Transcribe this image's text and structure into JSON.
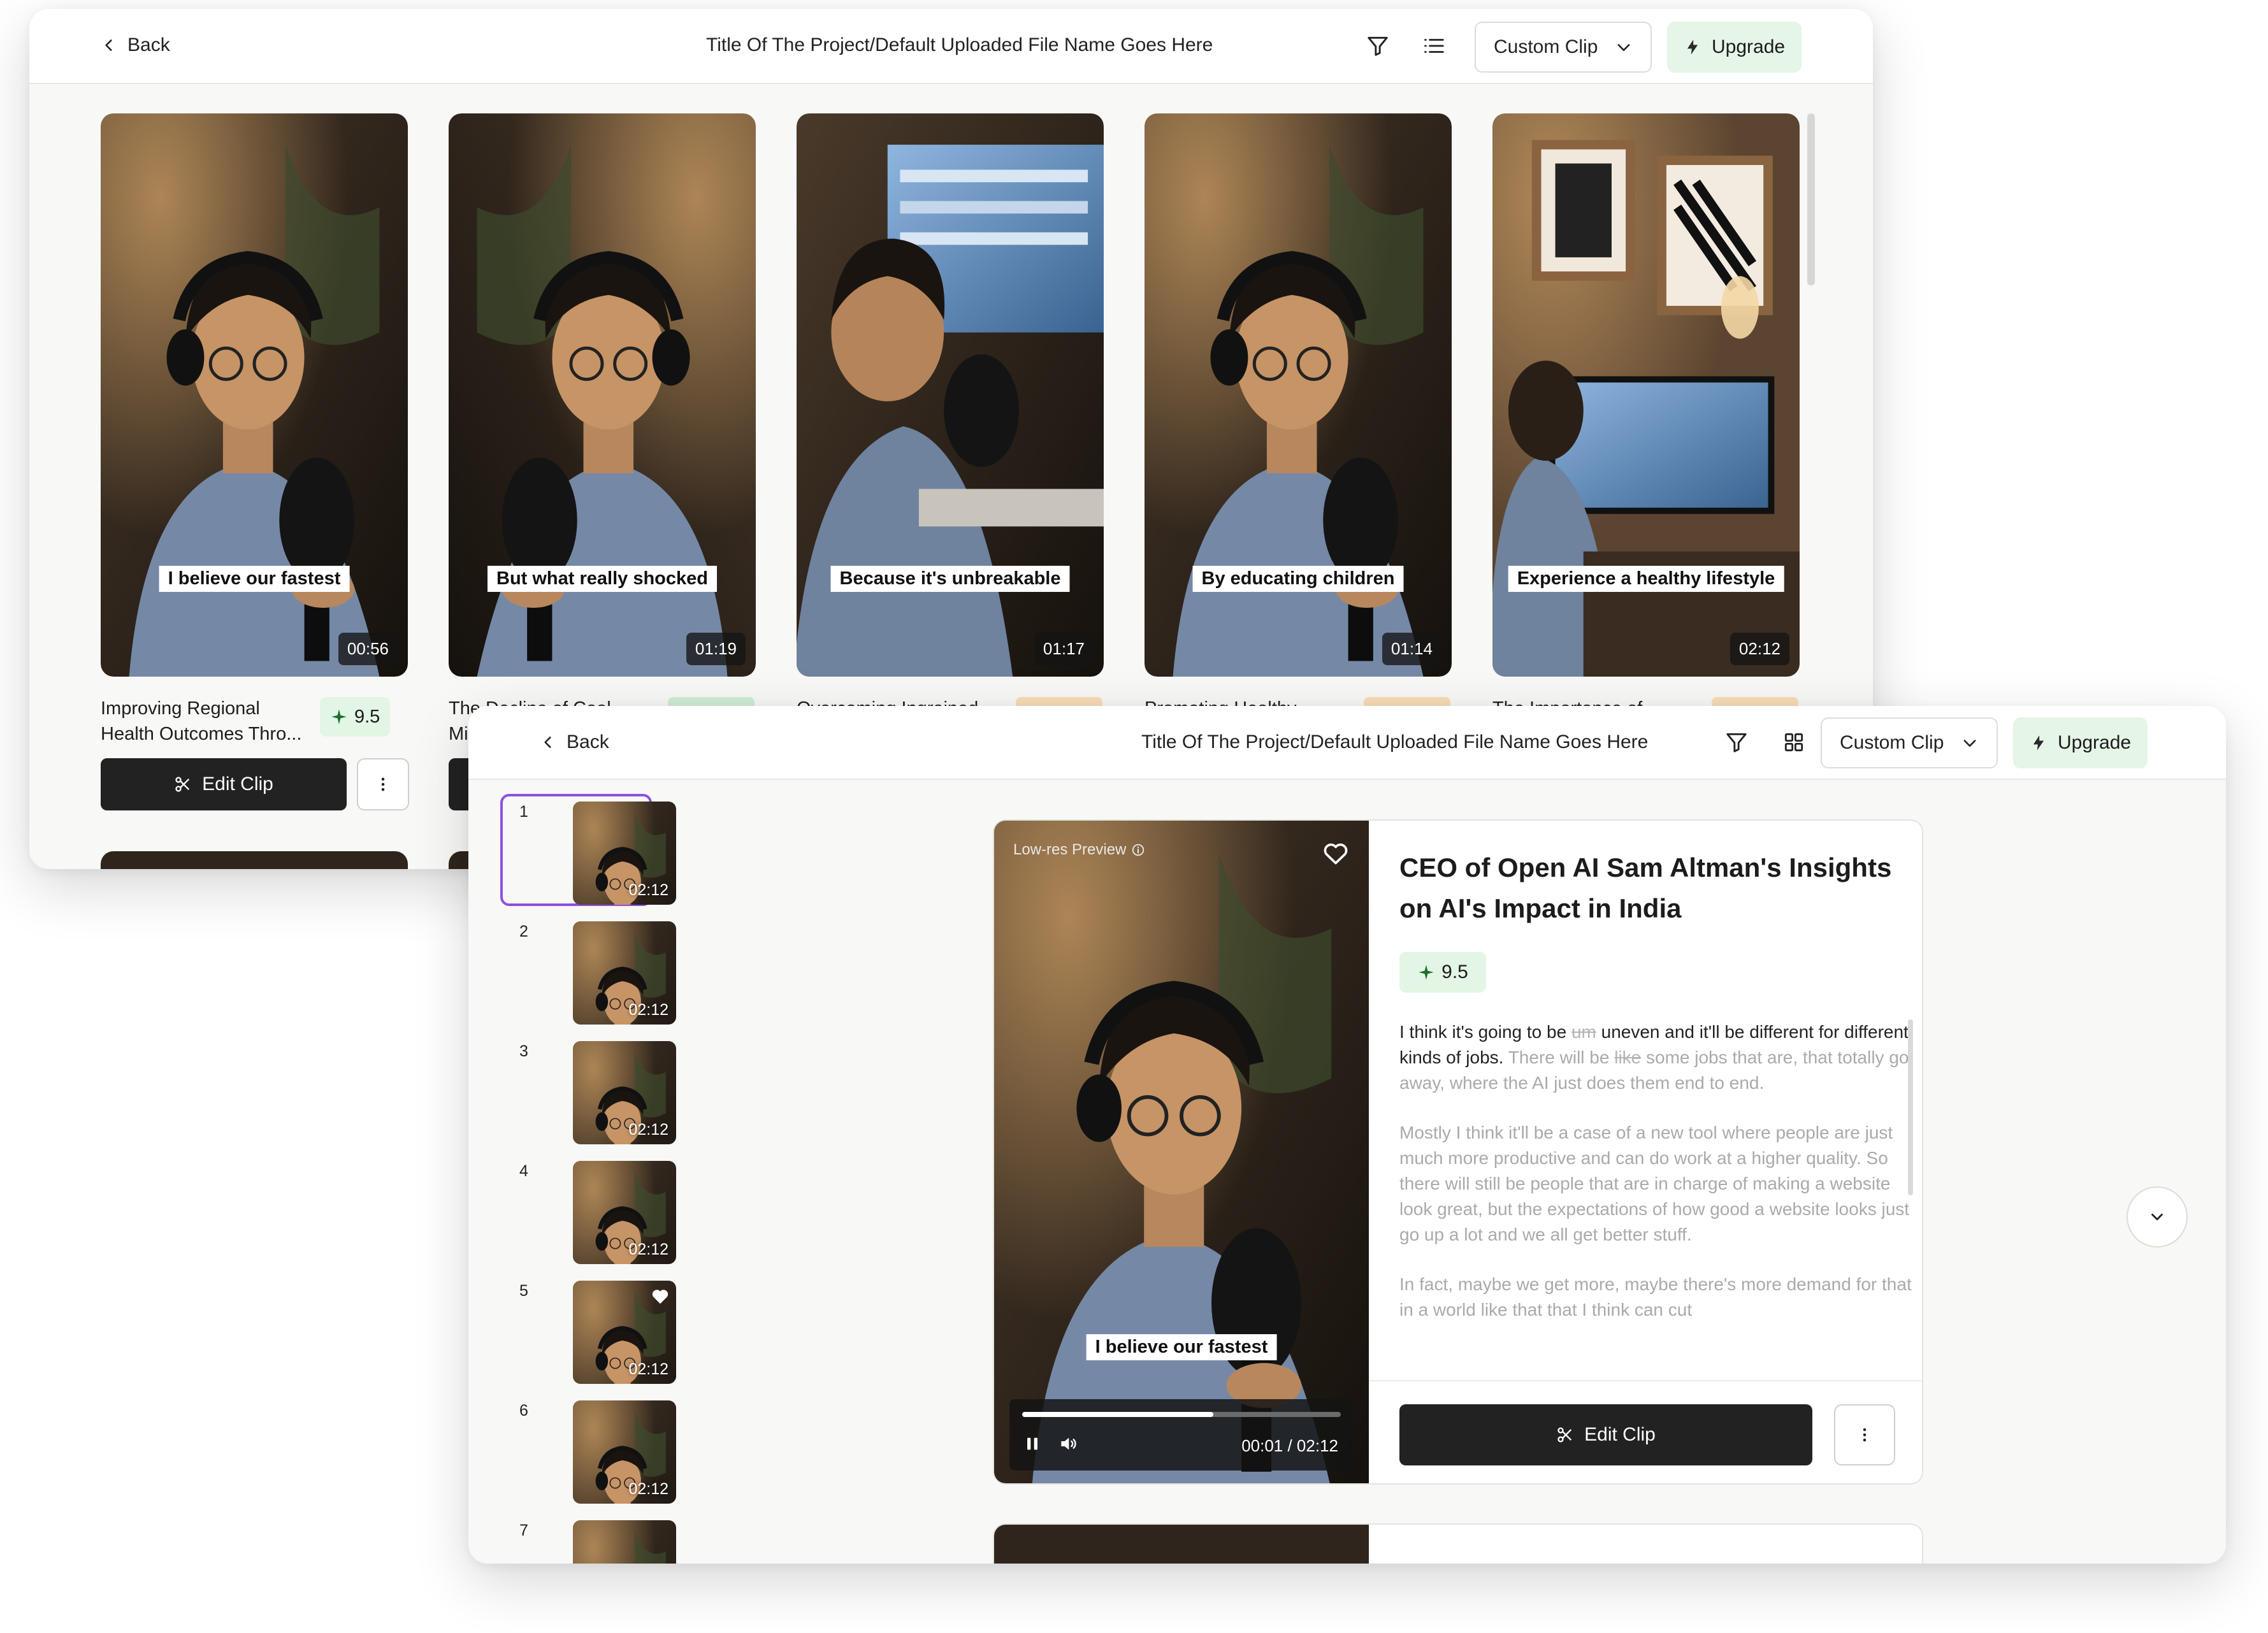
{
  "back_window": {
    "back_label": "Back",
    "title": "Title Of The Project/Default Uploaded File Name Goes Here",
    "clip_select": "Custom Clip",
    "upgrade_label": "Upgrade",
    "cards": [
      {
        "caption": "I believe our fastest",
        "duration": "00:56",
        "title_line1": "Improving Regional",
        "title_line2": "Health Outcomes Thro...",
        "score": "9.5",
        "edit_label": "Edit Clip"
      },
      {
        "caption": "But what really shocked",
        "duration": "01:19",
        "title_line1": "The Decline of Coal",
        "title_line2": "Mi"
      },
      {
        "caption": "Because it's unbreakable",
        "duration": "01:17",
        "title_line1": "Overcoming Ingrained"
      },
      {
        "caption": "By educating children",
        "duration": "01:14",
        "title_line1": "Promoting Healthy"
      },
      {
        "caption": "Experience a healthy lifestyle",
        "duration": "02:12",
        "title_line1": "The Importance of"
      }
    ]
  },
  "front_window": {
    "back_label": "Back",
    "title": "Title Of The Project/Default Uploaded File Name Goes Here",
    "clip_select": "Custom Clip",
    "upgrade_label": "Upgrade",
    "sidebar": [
      {
        "num": "1",
        "duration": "02:12",
        "selected": true
      },
      {
        "num": "2",
        "duration": "02:12"
      },
      {
        "num": "3",
        "duration": "02:12"
      },
      {
        "num": "4",
        "duration": "02:12"
      },
      {
        "num": "5",
        "duration": "02:12",
        "favorited": true
      },
      {
        "num": "6",
        "duration": "02:12"
      },
      {
        "num": "7",
        "duration": ""
      }
    ],
    "player": {
      "lowres_label": "Low-res Preview",
      "caption": "I believe our fastest",
      "time": "00:01 / 02:12",
      "progress_fraction": 0.6
    },
    "clip": {
      "title": "CEO of Open AI Sam Altman's Insights on AI's Impact in India",
      "score": "9.5",
      "transcript": {
        "p1_a": "I think it's going to be ",
        "p1_strike1": "um",
        "p1_b": " uneven and it'll be different for different kinds of jobs. ",
        "p1_c": "There will be ",
        "p1_strike2": "like",
        "p1_d": " some jobs that are, that totally go away, where the AI just does them end to end.",
        "p2": "Mostly I think it'll be a case of a new tool where people are just much more productive and can do work at a higher quality. So there will still be people that are in charge of making a website look great, but the expectations of how good a website looks just go up a lot and we all get better stuff.",
        "p3": "In fact, maybe we get more, maybe there's more demand for that in a world like that that I think can cut"
      },
      "edit_label": "Edit Clip"
    }
  },
  "colors": {
    "upgrade_bg": "#e5f5e6",
    "score_bg": "#e3f5e4",
    "selected_border": "#8f4fe0",
    "dark_button": "#222222",
    "orange_tag": "#f8ddb5",
    "green_tag": "#cfeed2"
  },
  "icons": [
    "chevron-left-icon",
    "filter-icon",
    "list-icon",
    "grid-icon",
    "chevron-down-icon",
    "bolt-icon",
    "sparkle-icon",
    "scissors-icon",
    "more-vertical-icon",
    "heart-icon",
    "info-icon",
    "pause-icon",
    "volume-icon"
  ]
}
